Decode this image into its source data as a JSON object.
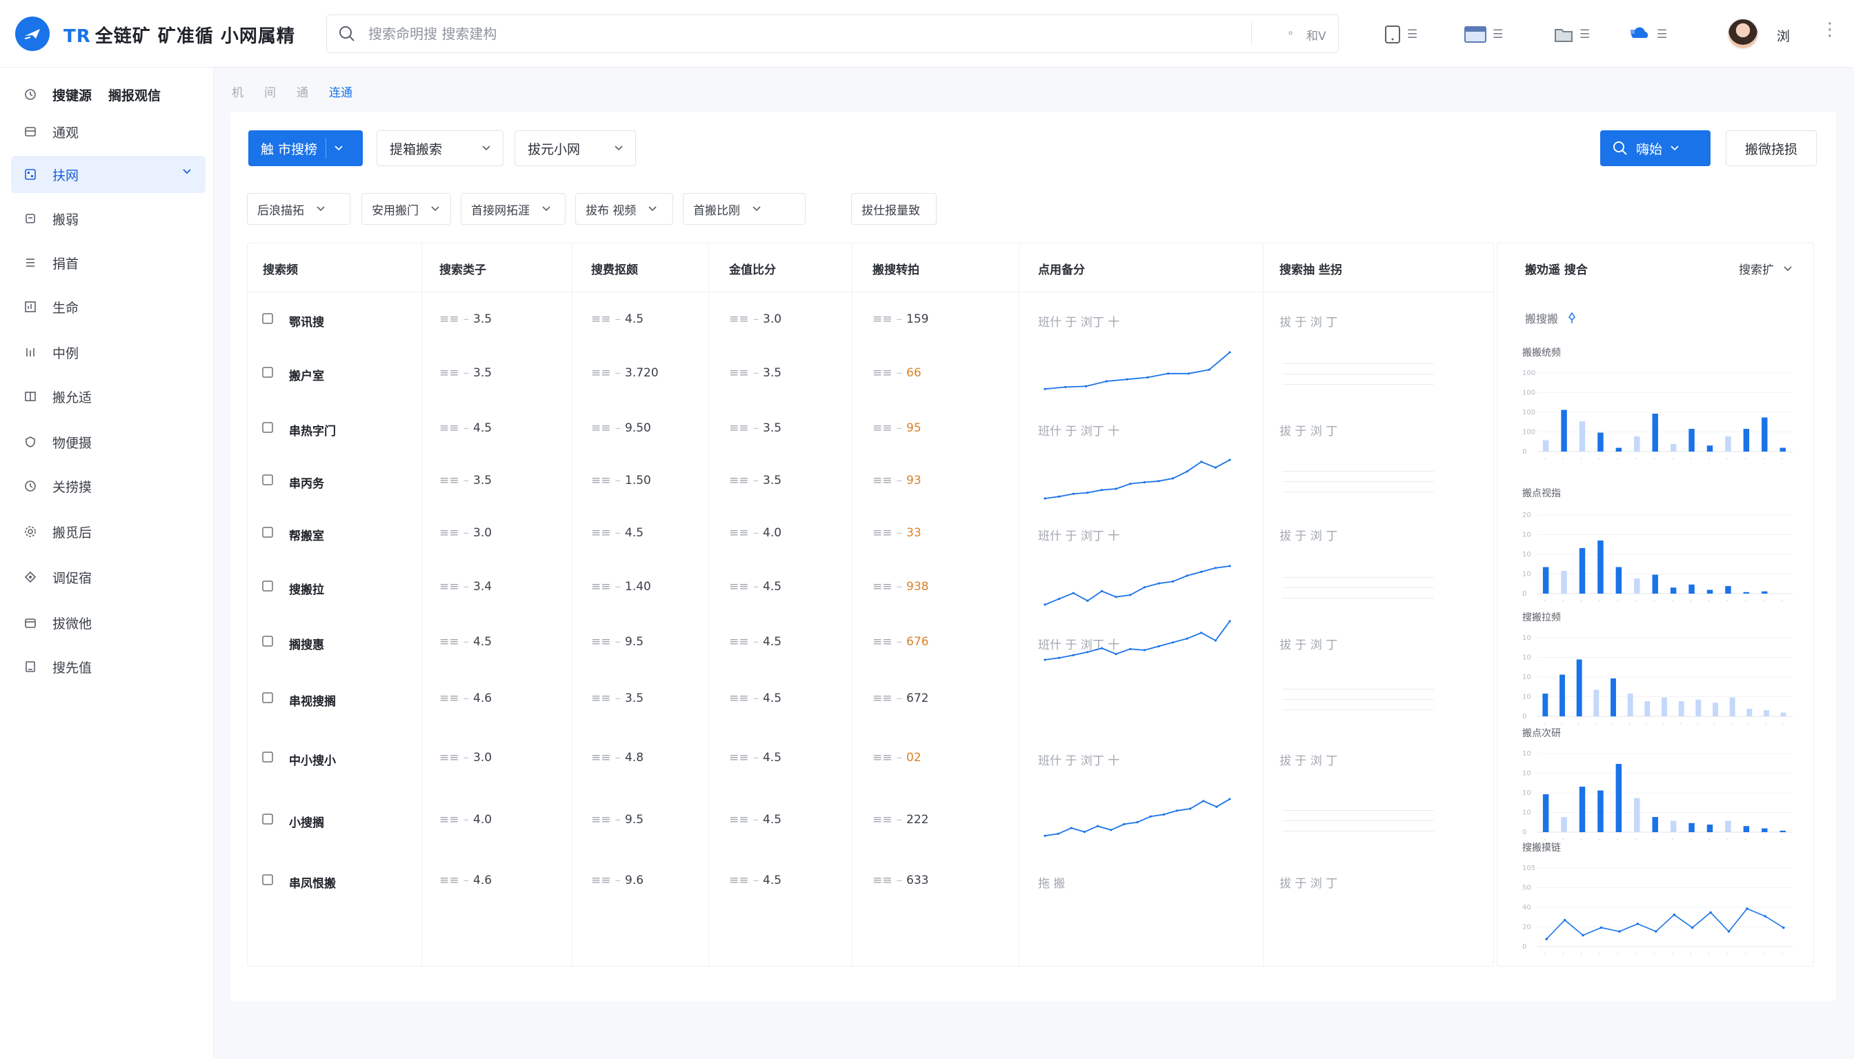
{
  "app": {
    "logo_text": "TR",
    "title": "全链矿 矿准循 小网属精"
  },
  "search": {
    "placeholder": "搜索命明搜 搜索建构",
    "option1": "∘",
    "option2": "和V"
  },
  "topbar": {
    "buttons": [
      {
        "label": "☰",
        "icon": "tablet-icon"
      },
      {
        "label": "☰",
        "icon": "calendar-icon"
      },
      {
        "label": "☰",
        "icon": "folder-icon"
      },
      {
        "label": "☰",
        "icon": "cloud-icon"
      }
    ],
    "user_name": "浏",
    "more": "⋮"
  },
  "sidebar": {
    "header": {
      "label": "搜键源",
      "label2": "搁报观信"
    },
    "items": [
      {
        "label": "通观",
        "icon": "layout-icon"
      },
      {
        "label": "扶网",
        "icon": "grid-icon",
        "active": true
      },
      {
        "label": "搬弱",
        "icon": "box-icon"
      },
      {
        "label": "捐首",
        "icon": "list-icon"
      },
      {
        "label": "生命",
        "icon": "chart-icon"
      },
      {
        "label": "中例",
        "icon": "bars-icon"
      },
      {
        "label": "搬允适",
        "icon": "panel-icon"
      },
      {
        "label": "物便摄",
        "icon": "shield-icon"
      },
      {
        "label": "关捞摸",
        "icon": "clock-icon"
      },
      {
        "label": "搬觅后",
        "icon": "settings-icon"
      },
      {
        "label": "调促宿",
        "icon": "tag-icon"
      },
      {
        "label": "拔微他",
        "icon": "calendar-icon"
      },
      {
        "label": "搜先值",
        "icon": "doc-icon"
      }
    ]
  },
  "breadcrumb": {
    "items": [
      "机",
      "间",
      "通"
    ],
    "current": "连通"
  },
  "toolbar": {
    "primary_label": "触 市搜榜",
    "dropdown1": "提箱搬索",
    "dropdown2": "拔元小网",
    "search_button": "嗨始",
    "right_button": "搬微挠损"
  },
  "filters": [
    "后浪描拓",
    "安用搬门",
    "首接网拓涯",
    "拔布 视频",
    "首搬比刚",
    "拔仕报量致"
  ],
  "table": {
    "headers": [
      "搜索频",
      "搜索类子",
      "搜费抠颇",
      "金值比分",
      "搬搜转拍",
      "点用备分",
      "搜索抽 些拐"
    ],
    "sparkline_label": "班什 于 浏丁 十",
    "rows": [
      {
        "name": "鄂讯搜",
        "c1": "3.5",
        "c2": "4.5",
        "c3": "3.0",
        "c4": "159",
        "orange": false,
        "c5": "班什 于 浏丁 十",
        "spark": [],
        "c6": "拔 于 浏 丁"
      },
      {
        "name": "搬户室",
        "c1": "3.5",
        "c2": "3.720",
        "c3": "3.5",
        "c4": "66",
        "orange": true,
        "c5": "",
        "spark": [
          0.05,
          0.1,
          0.12,
          0.25,
          0.3,
          0.35,
          0.45,
          0.45,
          0.55,
          1.0
        ],
        "c6": ""
      },
      {
        "name": "串热字门",
        "c1": "4.5",
        "c2": "9.50",
        "c3": "3.5",
        "c4": "95",
        "orange": true,
        "c5": "班什 于 浏丁 十",
        "spark": [],
        "c6": "拔 于 浏 丁"
      },
      {
        "name": "串丙务",
        "c1": "3.5",
        "c2": "1.50",
        "c3": "3.5",
        "c4": "93",
        "orange": true,
        "c5": "",
        "spark": [
          0.0,
          0.05,
          0.12,
          0.15,
          0.22,
          0.25,
          0.38,
          0.42,
          0.45,
          0.52,
          0.7,
          0.95,
          0.8,
          1.0
        ],
        "c6": ""
      },
      {
        "name": "帮搬室",
        "c1": "3.0",
        "c2": "4.5",
        "c3": "4.0",
        "c4": "33",
        "orange": true,
        "c5": "班什 于 浏丁 十",
        "spark": [],
        "c6": "拔 于 浏 丁"
      },
      {
        "name": "搜搬拉",
        "c1": "3.4",
        "c2": "1.40",
        "c3": "4.5",
        "c4": "938",
        "orange": true,
        "c5": "",
        "spark": [
          0.0,
          0.15,
          0.3,
          0.1,
          0.35,
          0.2,
          0.25,
          0.45,
          0.55,
          0.6,
          0.75,
          0.85,
          0.95,
          1.0
        ],
        "c6": ""
      },
      {
        "name": "搁搜惠",
        "c1": "4.5",
        "c2": "9.5",
        "c3": "4.5",
        "c4": "676",
        "orange": true,
        "c5": "班什 于 浏丁 十",
        "spark": [
          0.0,
          0.05,
          0.12,
          0.2,
          0.3,
          0.15,
          0.28,
          0.25,
          0.35,
          0.45,
          0.55,
          0.7,
          0.5,
          1.0
        ],
        "c6": "拔 于 浏 丁"
      },
      {
        "name": "串视搜搁",
        "c1": "4.6",
        "c2": "3.5",
        "c3": "4.5",
        "c4": "672",
        "orange": false,
        "c5": "",
        "spark": [],
        "c6": ""
      },
      {
        "name": "中小搜小",
        "c1": "3.0",
        "c2": "4.8",
        "c3": "4.5",
        "c4": "02",
        "orange": true,
        "c5": "班什 于 浏丁 十",
        "spark": [],
        "c6": "拔 于 浏 丁"
      },
      {
        "name": "小搜搁",
        "c1": "4.0",
        "c2": "9.5",
        "c3": "4.5",
        "c4": "222",
        "orange": false,
        "c5": "",
        "spark": [
          0.05,
          0.1,
          0.25,
          0.15,
          0.3,
          0.2,
          0.35,
          0.4,
          0.55,
          0.6,
          0.7,
          0.75,
          0.95,
          0.8,
          1.0
        ],
        "c6": ""
      },
      {
        "name": "串凤恨搬",
        "c1": "4.6",
        "c2": "9.6",
        "c3": "4.5",
        "c4": "633",
        "orange": false,
        "c5": "拖 搬",
        "spark": [],
        "c6": "拔 于 浏 丁"
      }
    ]
  },
  "side_panel": {
    "title": "搬劝遥 搜合",
    "sort_label": "搜索扩",
    "sub_label": "搬搜搬",
    "charts": [
      {
        "title": "搬搬统频",
        "type": "bar",
        "yticks": [
          "100",
          "100",
          "100",
          "100",
          "0"
        ],
        "values": [
          0.15,
          0.55,
          0.4,
          0.25,
          0.05,
          0.2,
          0.5,
          0.1,
          0.3,
          0.08,
          0.2,
          0.3,
          0.45,
          0.05
        ],
        "light": [
          1,
          0,
          1,
          0,
          0,
          1,
          0,
          1,
          0,
          0,
          1,
          0,
          0,
          0
        ]
      },
      {
        "title": "搬点视指",
        "type": "bar",
        "yticks": [
          "20",
          "10",
          "10",
          "10",
          "0"
        ],
        "values": [
          0.35,
          0.3,
          0.6,
          0.7,
          0.35,
          0.2,
          0.25,
          0.08,
          0.12,
          0.05,
          0.1,
          0.02,
          0.03,
          0.0
        ],
        "light": [
          0,
          1,
          0,
          0,
          0,
          1,
          0,
          0,
          0,
          0,
          0,
          0,
          0,
          0
        ]
      },
      {
        "title": "搜搬拉频",
        "type": "bar",
        "yticks": [
          "10",
          "10",
          "10",
          "10",
          "0"
        ],
        "values": [
          0.3,
          0.55,
          0.75,
          0.35,
          0.5,
          0.3,
          0.2,
          0.25,
          0.2,
          0.22,
          0.18,
          0.25,
          0.1,
          0.08,
          0.05
        ],
        "light": [
          0,
          0,
          0,
          1,
          0,
          1,
          1,
          1,
          1,
          1,
          1,
          1,
          1,
          1,
          1
        ]
      },
      {
        "title": "搬点次研",
        "type": "bar",
        "yticks": [
          "10",
          "10",
          "10",
          "10",
          "0"
        ],
        "values": [
          0.5,
          0.2,
          0.6,
          0.55,
          0.9,
          0.45,
          0.2,
          0.15,
          0.12,
          0.1,
          0.15,
          0.08,
          0.05,
          0.02
        ],
        "light": [
          0,
          1,
          0,
          0,
          0,
          1,
          0,
          1,
          0,
          0,
          1,
          0,
          0,
          0
        ]
      },
      {
        "title": "搜搬摸链",
        "type": "line",
        "yticks": [
          "105",
          "50",
          "40",
          "20",
          "0"
        ],
        "values": [
          0.1,
          0.35,
          0.15,
          0.25,
          0.2,
          0.3,
          0.2,
          0.42,
          0.25,
          0.45,
          0.2,
          0.5,
          0.4,
          0.25
        ]
      }
    ]
  },
  "colors": {
    "accent": "#1a73e8",
    "light_bar": "#c4d8fb",
    "orange": "#d9822b"
  }
}
